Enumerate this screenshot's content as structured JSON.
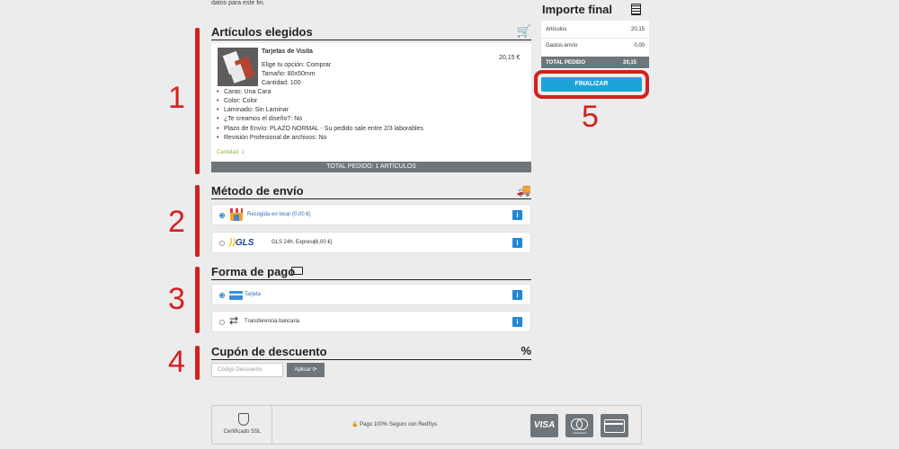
{
  "top_note": "datos para este fin.",
  "articles": {
    "title": "Artículos elegidos",
    "icon": "cart-icon",
    "product_name": "Tarjetas de Visita",
    "price": "20,15 €",
    "details": [
      "Elige tu opción: Comprar",
      "Tamaño: 80x50mm",
      "Cantidad: 100"
    ],
    "options": [
      "Caras: Una Cara",
      "Color: Color",
      "Laminado: Sin Laminar",
      "¿Te creamos el diseño?: No",
      "Plazo de Envío: PLAZO NORMAL - Su pedido sale entre 2/3 laborables",
      "Revisión Profesional de archivos: No"
    ],
    "quantity_note": "Cantidad: 1",
    "total_bar": "TOTAL PEDIDO: 1 ARTÍCULOS"
  },
  "shipping": {
    "title": "Método de envío",
    "icon": "truck-icon",
    "options": [
      {
        "label": "Recogida en local",
        "price": "(0,00 €)",
        "selected": true
      },
      {
        "label": "GLS 24h. Express",
        "price": "(6,00 €)",
        "selected": false
      }
    ],
    "gls_logo": "GLS"
  },
  "payment": {
    "title": "Forma de pago",
    "icon": "credit-card-icon",
    "options": [
      {
        "label": "Tarjeta",
        "selected": true
      },
      {
        "label": "Transferencia bancaria",
        "selected": false
      }
    ]
  },
  "coupon": {
    "title": "Cupón de descuento",
    "icon": "percent-icon",
    "placeholder": "Código Descuento",
    "apply_label": "Aplicar"
  },
  "summary": {
    "title": "Importe final",
    "icon": "calculator-icon",
    "rows": [
      {
        "label": "Artículos",
        "value": "20,15"
      },
      {
        "label": "Gastos envío",
        "value": "0,00"
      }
    ],
    "total_label": "TOTAL PEDIDO",
    "total_value": "20,15",
    "finalize_label": "FINALIZAR"
  },
  "annotations": [
    "1",
    "2",
    "3",
    "4",
    "5"
  ],
  "footer": {
    "ssl_label": "Certificado SSL",
    "secure_label": "Pago 100% Seguro con RedSys",
    "visa_label": "VISA",
    "mastercard_label": "mastercard"
  },
  "colors": {
    "accent_blue": "#1ea3d8",
    "annotation_red": "#d42020",
    "bar_grey": "#6f767b",
    "qty_green": "#8bb63a"
  }
}
